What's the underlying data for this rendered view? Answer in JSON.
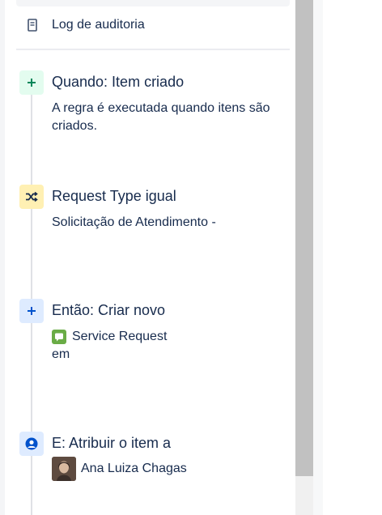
{
  "audit": {
    "label": "Log de auditoria",
    "icon": "document-icon"
  },
  "steps": [
    {
      "kind": "trigger",
      "icon": "plus-icon",
      "color": "#00875a",
      "title": "Quando: Item criado",
      "description": "A regra é executada quando itens são criados."
    },
    {
      "kind": "condition",
      "icon": "shuffle-icon",
      "color": "#172b4d",
      "title": "Request Type igual",
      "description": "Solicitação de Atendimento -"
    },
    {
      "kind": "action",
      "icon": "plus-icon",
      "color": "#0052cc",
      "title": "Então: Criar novo",
      "item_label": "Service Request",
      "item_icon": "chat-bubble-icon",
      "suffix": "em"
    },
    {
      "kind": "action",
      "icon": "user-circle-icon",
      "color": "#0052cc",
      "title": "E: Atribuir o item a",
      "assignee": "Ana Luiza Chagas"
    }
  ],
  "colors": {
    "text": "#172b4d",
    "trigger_bg": "#e3fcef",
    "condition_bg": "#fff0b3",
    "action_bg": "#deebff",
    "service_request": "#6aac46"
  }
}
